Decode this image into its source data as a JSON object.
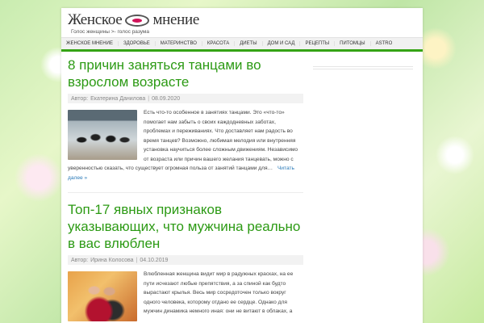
{
  "site": {
    "logo_left": "Женское",
    "logo_right": "мнение",
    "tagline": "Голос женщины >- голос разума"
  },
  "nav": {
    "items": [
      {
        "label": "Женское мнение"
      },
      {
        "label": "Здоровье"
      },
      {
        "label": "Материнство"
      },
      {
        "label": "Красота"
      },
      {
        "label": "Диеты"
      },
      {
        "label": "Дом и сад"
      },
      {
        "label": "Рецепты"
      },
      {
        "label": "Питомцы"
      },
      {
        "label": "Astro"
      }
    ]
  },
  "posts": [
    {
      "title": "8 причин заняться танцами во взрослом возрасте",
      "author_label": "Автор:",
      "author": "Екатерина Данилова",
      "date": "08.09.2020",
      "excerpt": "Есть что-то особенное в занятиях танцами. Это «что-то» помогает нам забыть о своих каждодневных заботах, проблемах и переживаниях. Что доставляет нам радость во время танцев? Возможно, любимая мелодия или внутренняя установка научиться более сложным движениям. Независимо от возраста или причин вашего желания танцевать, можно с уверенностью сказать, что существует огромная польза от занятий танцами для…",
      "read_more": "Читать далее »"
    },
    {
      "title": "Топ-17 явных признаков указывающих, что мужчина реально в вас влюблен",
      "author_label": "Автор:",
      "author": "Ирина Колосова",
      "date": "04.10.2019",
      "excerpt": "Влюбленная женщина видит мир в радужных красках, на ее пути исчезают любые препятствия, а за спиной как будто вырастают крылья. Весь мир сосредоточен только вокруг одного человека, которому отдано ее сердце. Однако для мужчин динамика немного иная: они не витают в облаках, а"
    }
  ]
}
